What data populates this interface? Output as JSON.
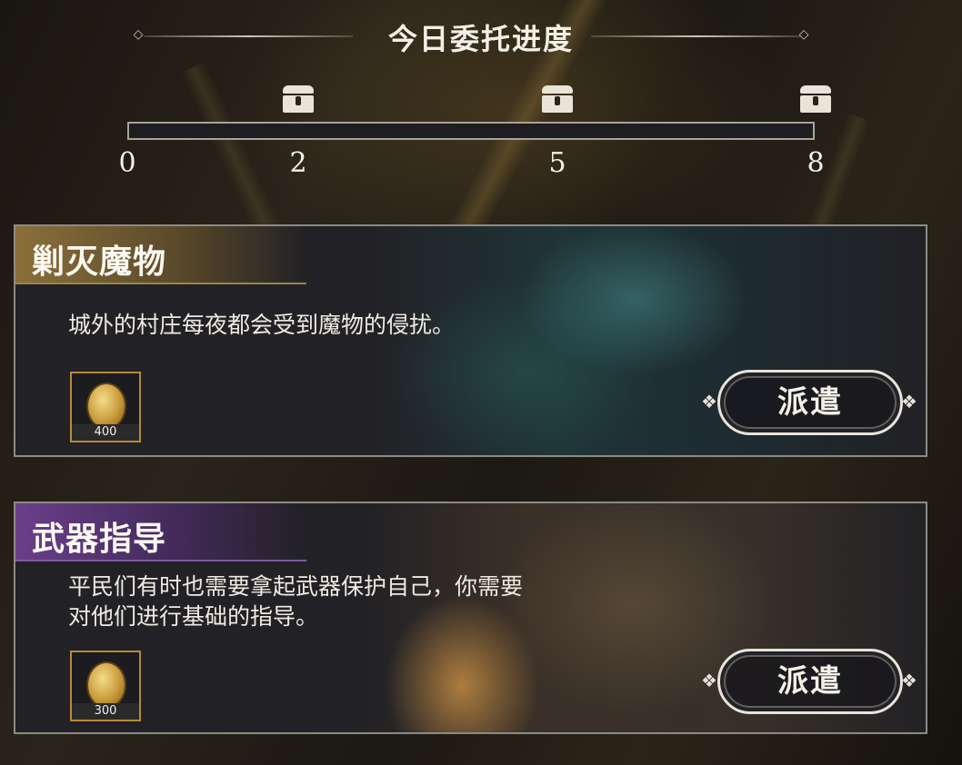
{
  "progress": {
    "title": "今日委托进度",
    "current": 0,
    "max": 8,
    "ticks": [
      "0",
      "2",
      "5",
      "8"
    ],
    "milestones": [
      2,
      5,
      8
    ],
    "fill_color": "#d8b35a"
  },
  "missions": [
    {
      "title": "剿灭魔物",
      "description": "城外的村庄每夜都会受到魔物的侵扰。",
      "reward_icon": "gold-coin-icon",
      "reward_count": "400",
      "dispatch_label": "派遣",
      "header_color": "#8a6f3a"
    },
    {
      "title": "武器指导",
      "description_lines": [
        "平民们有时也需要拿起武器保护自己，你需要",
        "对他们进行基础的指导。"
      ],
      "reward_icon": "gold-coin-icon",
      "reward_count": "300",
      "dispatch_label": "派遣",
      "header_color": "#6a3f8a"
    }
  ]
}
